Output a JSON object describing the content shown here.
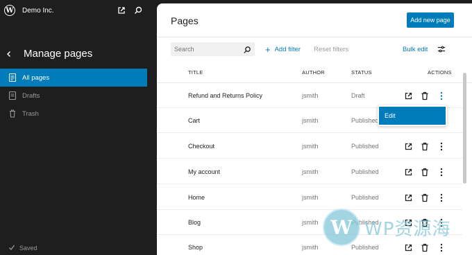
{
  "site": {
    "name": "Demo Inc.",
    "logo": "wordpress-logo-icon"
  },
  "sidebar": {
    "title": "Manage pages",
    "items": [
      {
        "label": "All pages",
        "icon": "pages-icon",
        "active": true
      },
      {
        "label": "Drafts",
        "icon": "drafts-icon",
        "active": false
      },
      {
        "label": "Trash",
        "icon": "trash-icon",
        "active": false
      }
    ],
    "status": "Saved"
  },
  "main": {
    "title": "Pages",
    "add_button": "Add new page",
    "search": {
      "placeholder": "Search",
      "value": ""
    },
    "add_filter": "Add filter",
    "reset_filters": "Reset filters",
    "bulk_edit": "Bulk edit",
    "columns": {
      "title": "TITLE",
      "author": "AUTHOR",
      "status": "STATUS",
      "actions": "ACTIONS"
    },
    "rows": [
      {
        "title": "Refund and Returns Policy",
        "author": "jsmith",
        "status": "Draft"
      },
      {
        "title": "Cart",
        "author": "jsmith",
        "status": "Published"
      },
      {
        "title": "Checkout",
        "author": "jsmith",
        "status": "Published"
      },
      {
        "title": "My account",
        "author": "jsmith",
        "status": "Published"
      },
      {
        "title": "Home",
        "author": "jsmith",
        "status": "Published"
      },
      {
        "title": "Blog",
        "author": "jsmith",
        "status": "Published"
      },
      {
        "title": "Shop",
        "author": "jsmith",
        "status": "Published"
      }
    ],
    "row_menu": {
      "open_on_row": 0,
      "items": [
        "Edit"
      ]
    }
  },
  "watermark": {
    "text": "WP资源海"
  },
  "colors": {
    "accent": "#007cba",
    "sidebar_bg": "#1e1e1e",
    "panel_bg": "#ffffff"
  }
}
